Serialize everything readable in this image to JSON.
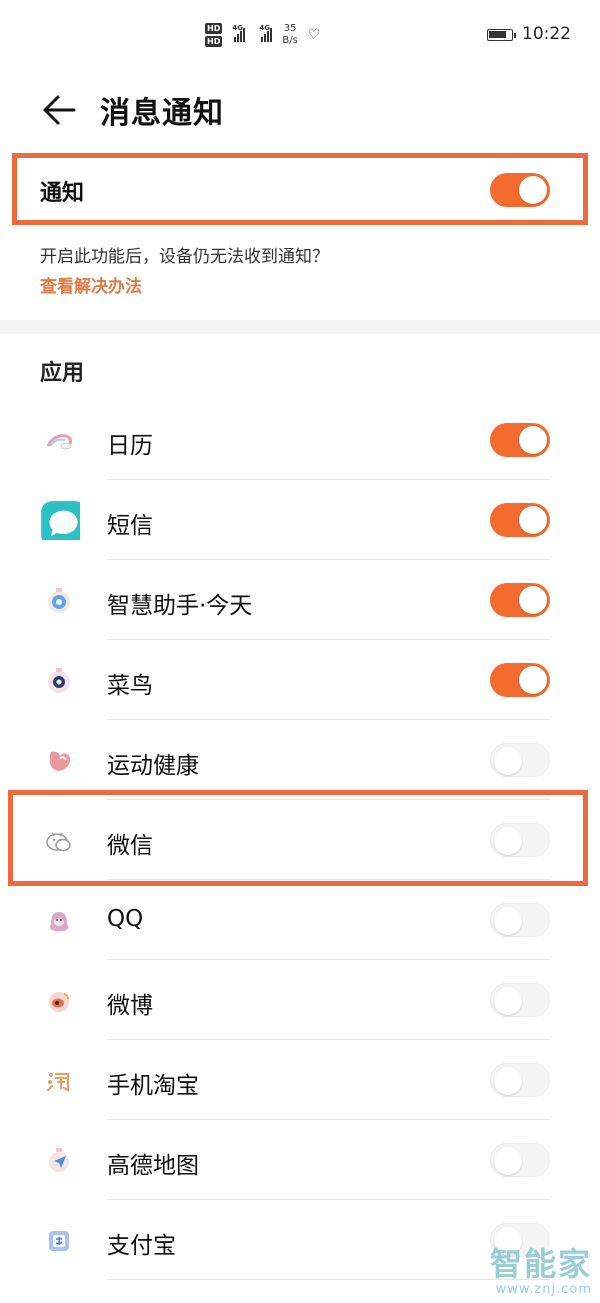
{
  "status_bar": {
    "hd_1": "HD",
    "hd_2": "HD",
    "net_1": "4G",
    "net_2": "4G",
    "speed_value": "35",
    "speed_unit": "B/s",
    "time": "10:22"
  },
  "header": {
    "title": "消息通知"
  },
  "notification": {
    "label": "通知",
    "enabled": true,
    "hint": "开启此功能后，设备仍无法收到通知？",
    "link": "查看解决办法"
  },
  "section": {
    "title": "应用"
  },
  "apps": [
    {
      "name": "日历",
      "enabled": true,
      "icon": "calendar-icon"
    },
    {
      "name": "短信",
      "enabled": true,
      "icon": "messages-icon"
    },
    {
      "name": "智慧助手·今天",
      "enabled": true,
      "icon": "assistant-icon"
    },
    {
      "name": "菜鸟",
      "enabled": true,
      "icon": "cainiao-icon"
    },
    {
      "name": "运动健康",
      "enabled": false,
      "icon": "health-icon"
    },
    {
      "name": "微信",
      "enabled": false,
      "icon": "wechat-icon"
    },
    {
      "name": "QQ",
      "enabled": false,
      "icon": "qq-icon"
    },
    {
      "name": "微博",
      "enabled": false,
      "icon": "weibo-icon"
    },
    {
      "name": "手机淘宝",
      "enabled": false,
      "icon": "taobao-icon"
    },
    {
      "name": "高德地图",
      "enabled": false,
      "icon": "amap-icon"
    },
    {
      "name": "支付宝",
      "enabled": false,
      "icon": "alipay-icon"
    }
  ],
  "watermark": {
    "main": "智能家",
    "sub": "www.znj.com"
  },
  "colors": {
    "accent": "#f36b2e",
    "highlight": "#ee6a3e",
    "link": "#e27a45"
  }
}
